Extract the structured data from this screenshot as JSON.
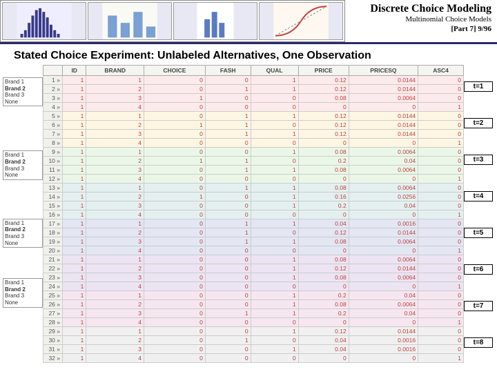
{
  "header": {
    "title_main": "Discrete Choice Modeling",
    "title_sub": "Multinomial Choice Models",
    "title_part": "[Part 7]   9/96"
  },
  "slide_title": "Stated Choice Experiment: Unlabeled Alternatives, One Observation",
  "brand_blocks": [
    [
      "Brand 1",
      "Brand 2",
      "Brand 3",
      "None"
    ],
    [
      "Brand 1",
      "Brand 2",
      "Brand 3",
      "None"
    ],
    [
      "Brand 1",
      "Brand 2",
      "Brand 3",
      "None"
    ],
    [
      "Brand 1",
      "Brand 2",
      "Brand 3",
      "None"
    ]
  ],
  "t_labels": [
    "t=1",
    "t=2",
    "t=3",
    "t=4",
    "t=5",
    "t=6",
    "t=7",
    "t=8"
  ],
  "columns": [
    "",
    "ID",
    "BRAND",
    "CHOICE",
    "FASH",
    "QUAL",
    "PRICE",
    "PRICESQ",
    "ASC4"
  ],
  "rows": [
    {
      "c": 1,
      "n": "1 »",
      "v": [
        "1",
        "1",
        "0",
        "0",
        "1",
        "0.12",
        "0.0144",
        "0"
      ]
    },
    {
      "c": 1,
      "n": "2 »",
      "v": [
        "1",
        "2",
        "0",
        "1",
        "1",
        "0.12",
        "0.0144",
        "0"
      ]
    },
    {
      "c": 1,
      "n": "3 »",
      "v": [
        "1",
        "3",
        "1",
        "0",
        "0",
        "0.08",
        "0.0064",
        "0"
      ]
    },
    {
      "c": 1,
      "n": "4 »",
      "v": [
        "1",
        "4",
        "0",
        "0",
        "0",
        "0",
        "0",
        "1"
      ]
    },
    {
      "c": 2,
      "n": "5 »",
      "v": [
        "1",
        "1",
        "0",
        "1",
        "1",
        "0.12",
        "0.0144",
        "0"
      ]
    },
    {
      "c": 2,
      "n": "6 »",
      "v": [
        "1",
        "2",
        "1",
        "1",
        "0",
        "0.12",
        "0.0144",
        "0"
      ]
    },
    {
      "c": 2,
      "n": "7 »",
      "v": [
        "1",
        "3",
        "0",
        "1",
        "1",
        "0.12",
        "0.0144",
        "0"
      ]
    },
    {
      "c": 2,
      "n": "8 »",
      "v": [
        "1",
        "4",
        "0",
        "0",
        "0",
        "0",
        "0",
        "1"
      ]
    },
    {
      "c": 3,
      "n": "9 »",
      "v": [
        "1",
        "1",
        "0",
        "0",
        "1",
        "0.08",
        "0.0064",
        "0"
      ]
    },
    {
      "c": 3,
      "n": "10 »",
      "v": [
        "1",
        "2",
        "1",
        "1",
        "0",
        "0.2",
        "0.04",
        "0"
      ]
    },
    {
      "c": 3,
      "n": "11 »",
      "v": [
        "1",
        "3",
        "0",
        "1",
        "1",
        "0.08",
        "0.0064",
        "0"
      ]
    },
    {
      "c": 3,
      "n": "12 »",
      "v": [
        "1",
        "4",
        "0",
        "0",
        "0",
        "0",
        "0",
        "1"
      ]
    },
    {
      "c": 4,
      "n": "13 »",
      "v": [
        "1",
        "1",
        "0",
        "1",
        "1",
        "0.08",
        "0.0064",
        "0"
      ]
    },
    {
      "c": 4,
      "n": "14 »",
      "v": [
        "1",
        "2",
        "1",
        "0",
        "1",
        "0.16",
        "0.0256",
        "0"
      ]
    },
    {
      "c": 4,
      "n": "15 »",
      "v": [
        "1",
        "3",
        "0",
        "0",
        "1",
        "0.2",
        "0.04",
        "0"
      ]
    },
    {
      "c": 4,
      "n": "16 »",
      "v": [
        "1",
        "4",
        "0",
        "0",
        "0",
        "0",
        "0",
        "1"
      ]
    },
    {
      "c": 5,
      "n": "17 »",
      "v": [
        "1",
        "1",
        "0",
        "1",
        "1",
        "0.04",
        "0.0016",
        "0"
      ]
    },
    {
      "c": 5,
      "n": "18 »",
      "v": [
        "1",
        "2",
        "0",
        "1",
        "0",
        "0.12",
        "0.0144",
        "0"
      ]
    },
    {
      "c": 5,
      "n": "19 »",
      "v": [
        "1",
        "3",
        "0",
        "1",
        "1",
        "0.08",
        "0.0064",
        "0"
      ]
    },
    {
      "c": 5,
      "n": "20 »",
      "v": [
        "1",
        "4",
        "0",
        "0",
        "0",
        "0",
        "0",
        "1"
      ]
    },
    {
      "c": 6,
      "n": "21 »",
      "v": [
        "1",
        "1",
        "0",
        "0",
        "1",
        "0.08",
        "0.0064",
        "0"
      ]
    },
    {
      "c": 6,
      "n": "22 »",
      "v": [
        "1",
        "2",
        "0",
        "0",
        "1",
        "0.12",
        "0.0144",
        "0"
      ]
    },
    {
      "c": 6,
      "n": "23 »",
      "v": [
        "1",
        "3",
        "0",
        "0",
        "1",
        "0.08",
        "0.0064",
        "0"
      ]
    },
    {
      "c": 6,
      "n": "24 »",
      "v": [
        "1",
        "4",
        "0",
        "0",
        "0",
        "0",
        "0",
        "1"
      ]
    },
    {
      "c": 7,
      "n": "25 »",
      "v": [
        "1",
        "1",
        "0",
        "0",
        "1",
        "0.2",
        "0.04",
        "0"
      ]
    },
    {
      "c": 7,
      "n": "26 »",
      "v": [
        "1",
        "2",
        "0",
        "0",
        "1",
        "0.08",
        "0.0064",
        "0"
      ]
    },
    {
      "c": 7,
      "n": "27 »",
      "v": [
        "1",
        "3",
        "0",
        "1",
        "1",
        "0.2",
        "0.04",
        "0"
      ]
    },
    {
      "c": 7,
      "n": "28 »",
      "v": [
        "1",
        "4",
        "0",
        "0",
        "0",
        "0",
        "0",
        "1"
      ]
    },
    {
      "c": 8,
      "n": "29 »",
      "v": [
        "1",
        "1",
        "0",
        "0",
        "1",
        "0.12",
        "0.0144",
        "0"
      ]
    },
    {
      "c": 8,
      "n": "30 »",
      "v": [
        "1",
        "2",
        "0",
        "1",
        "0",
        "0.04",
        "0.0016",
        "0"
      ]
    },
    {
      "c": 8,
      "n": "31 »",
      "v": [
        "1",
        "3",
        "0",
        "0",
        "1",
        "0.04",
        "0.0016",
        "0"
      ]
    },
    {
      "c": 8,
      "n": "32 »",
      "v": [
        "1",
        "4",
        "0",
        "0",
        "0",
        "0",
        "0",
        "1"
      ]
    }
  ]
}
